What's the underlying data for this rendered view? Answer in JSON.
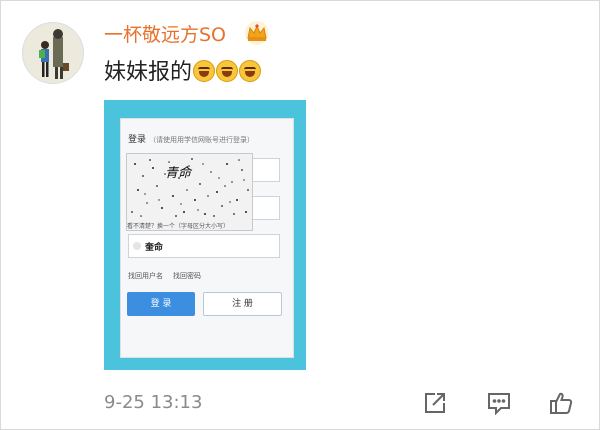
{
  "post": {
    "username": "一杯敬远方SO",
    "text": "妹妹报的",
    "emoji_count": 3,
    "emoji_name": "laughing-tears-emoji",
    "timestamp": "9-25 13:13"
  },
  "embedded_screenshot": {
    "login_title": "登录",
    "login_hint": "（请使用用学信网账号进行登录）",
    "captcha_text": "青命",
    "captcha_hint": "看不清楚？换一个（字母区分大小写）",
    "captcha_input_value": "奎命",
    "links": [
      "找回用户名",
      "找回密码"
    ],
    "login_button": "登 录",
    "register_button": "注 册"
  },
  "actions": {
    "icons": [
      "share-icon",
      "comment-icon",
      "like-icon"
    ]
  },
  "colors": {
    "username": "#e8722b",
    "screenshot_background": "#4cc3dd",
    "login_button": "#3b8ee0",
    "timestamp": "#8a8a8a"
  }
}
